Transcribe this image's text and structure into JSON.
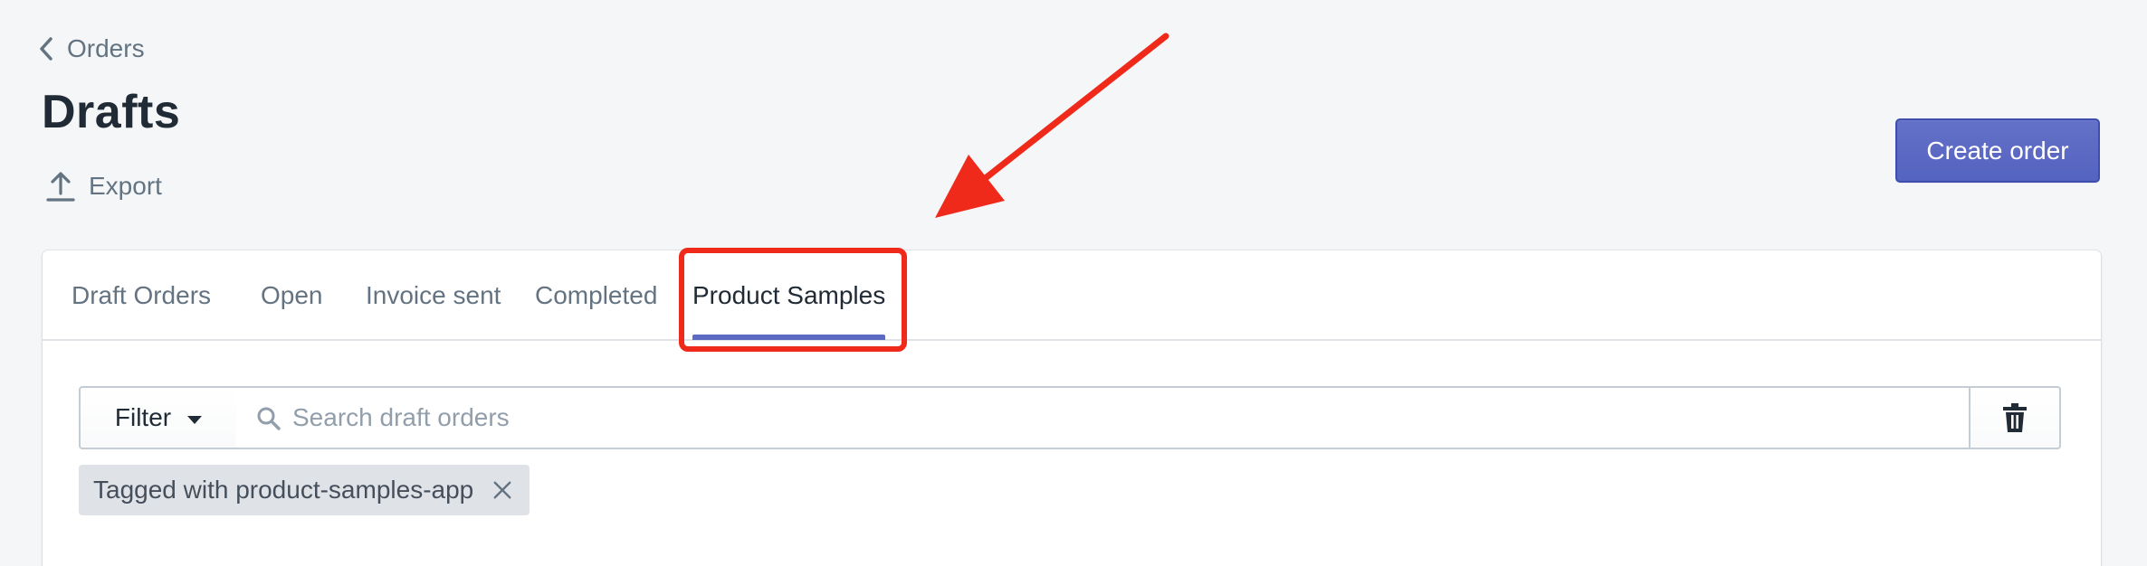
{
  "breadcrumb": {
    "label": "Orders",
    "icon": "chevron-left-icon"
  },
  "page": {
    "title": "Drafts"
  },
  "actions": {
    "export_label": "Export",
    "export_icon": "upload-icon",
    "create_order_label": "Create order"
  },
  "tabs": [
    {
      "label": "Draft Orders",
      "active": false
    },
    {
      "label": "Open",
      "active": false
    },
    {
      "label": "Invoice sent",
      "active": false
    },
    {
      "label": "Completed",
      "active": false
    },
    {
      "label": "Product Samples",
      "active": true
    }
  ],
  "filters": {
    "filter_label": "Filter",
    "filter_icon": "caret-down-icon",
    "search_placeholder": "Search draft orders",
    "search_value": "",
    "search_icon": "search-icon",
    "delete_icon": "trash-icon",
    "applied_tag": "Tagged with product-samples-app",
    "applied_tag_remove_icon": "close-icon"
  },
  "annotation": {
    "color": "#f02a1b",
    "arrow_icon": "arrow-icon"
  },
  "colors": {
    "primary": "#5c6ac4",
    "background": "#f4f6f8",
    "text": "#212b36",
    "subdued": "#637381"
  }
}
